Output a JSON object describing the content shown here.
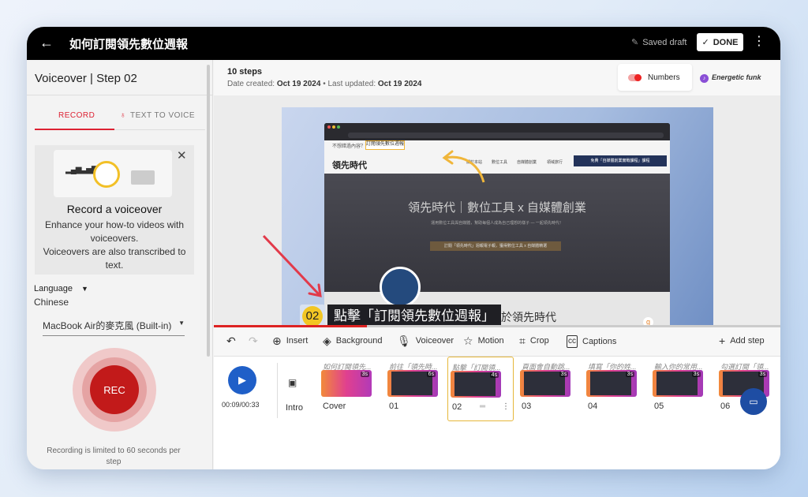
{
  "header": {
    "back_icon": "arrow-left-icon",
    "title": "如何訂閱領先數位週報",
    "saved_label": "Saved draft",
    "done_label": "DONE",
    "more_icon": "kebab-icon"
  },
  "left": {
    "title": "Voiceover | Step 02",
    "tab_record": "RECORD",
    "tab_tts": "TEXT TO VOICE",
    "card_title": "Record a voiceover",
    "card_desc": "Enhance your how-to videos with voiceovers.\nVoiceovers are also transcribed to text.",
    "language_label": "Language",
    "language_value": "Chinese",
    "mic_value": "MacBook Air的麥克風 (Built-in)",
    "rec_label": "REC",
    "limit_note": "Recording is limited to 60 seconds per step"
  },
  "main": {
    "steps_count": "10 steps",
    "date_created_label": "Date created:",
    "date_created": "Oct 19 2024",
    "last_updated_label": "• Last updated:",
    "last_updated": "Oct 19 2024",
    "numbers_label": "Numbers",
    "numbers_on": true,
    "music_label": "Energetic funk"
  },
  "screenshot": {
    "top_link": "不想錯過內容？",
    "highlight_link": "訂閱領先數位週報",
    "logo": "領先時代",
    "nav": [
      "關於本站",
      "數位工具",
      "自媒體創業",
      "領域旅行"
    ],
    "cta": "免費「自媒體創業實戰課程」課程",
    "hero_title": "領先時代｜數位工具 x 自媒體創業",
    "hero_sub": "運用數位工具與自媒體，幫助每個人成為自己理想的樣子 — 一起領先時代！",
    "hero_button": "訂閱「領先時代」週報電子報，獲得數位工具 x 自媒體精選",
    "hero_bottom": "關於領先時代",
    "step_number": "02",
    "callout_text": "點擊「訂閱領先數位週報」"
  },
  "progress": {
    "fraction": 0.27
  },
  "toolbar": {
    "insert": "Insert",
    "background": "Background",
    "voiceover": "Voiceover",
    "motion": "Motion",
    "crop": "Crop",
    "captions": "Captions",
    "add_step": "Add step"
  },
  "timeline": {
    "time": "00:09/00:33",
    "intro": "Intro",
    "clips": [
      {
        "caption": "如何訂閱領先...",
        "duration": "3s",
        "label": "Cover"
      },
      {
        "caption": "前往「領先時...",
        "duration": "6s",
        "label": "01"
      },
      {
        "caption": "點擊「訂閱領...",
        "duration": "4s",
        "label": "02"
      },
      {
        "caption": "頁面會自動跳...",
        "duration": "3s",
        "label": "03"
      },
      {
        "caption": "填寫「你的姓...",
        "duration": "3s",
        "label": "04"
      },
      {
        "caption": "輸入你的常用...",
        "duration": "3s",
        "label": "05"
      },
      {
        "caption": "勾選訂閱「領...",
        "duration": "3s",
        "label": "06"
      }
    ]
  },
  "colors": {
    "accent": "#d22222",
    "play": "#1f5fc8",
    "highlight": "#f2c624"
  }
}
